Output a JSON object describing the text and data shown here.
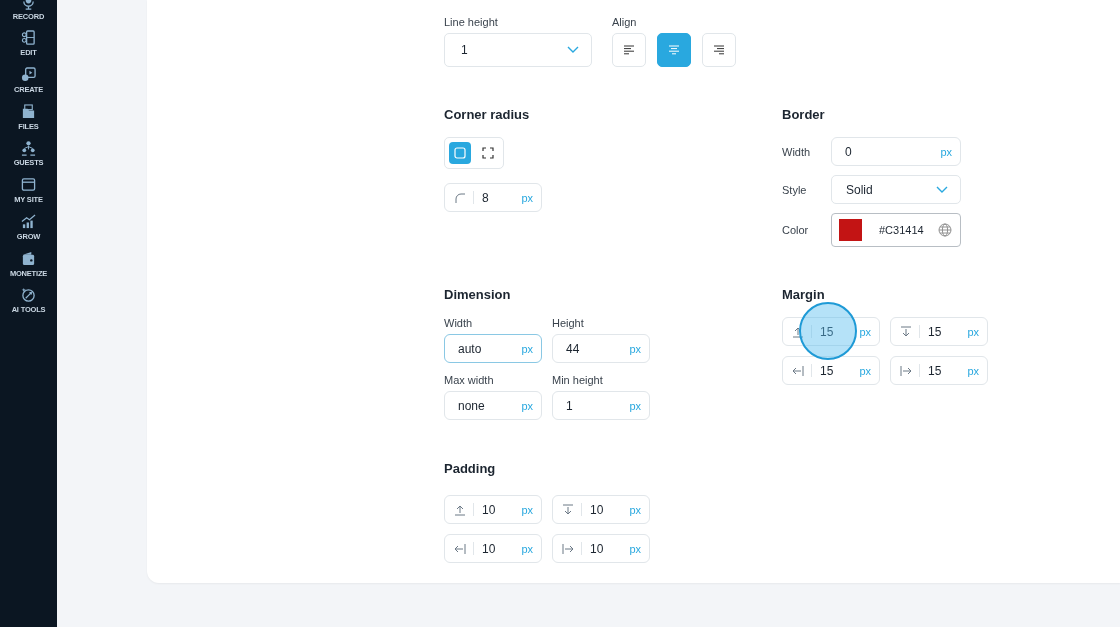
{
  "sidebar": {
    "items": [
      {
        "label": "RECORD"
      },
      {
        "label": "EDIT"
      },
      {
        "label": "CREATE"
      },
      {
        "label": "FILES"
      },
      {
        "label": "GUESTS"
      },
      {
        "label": "MY SITE"
      },
      {
        "label": "GROW"
      },
      {
        "label": "MONETIZE"
      },
      {
        "label": "AI TOOLS"
      }
    ]
  },
  "line_height": {
    "label": "Line height",
    "value": "1"
  },
  "align": {
    "label": "Align",
    "options": [
      {
        "kind": "left",
        "selected": false
      },
      {
        "kind": "center",
        "selected": true
      },
      {
        "kind": "right",
        "selected": false
      }
    ]
  },
  "corner_radius": {
    "title": "Corner radius",
    "modes": [
      {
        "kind": "uniform",
        "selected": true
      },
      {
        "kind": "individual",
        "selected": false
      }
    ],
    "field": {
      "kind": "corner",
      "value": "8",
      "unit": "px"
    }
  },
  "border": {
    "title": "Border",
    "width": {
      "label": "Width",
      "value": "0",
      "unit": "px"
    },
    "style": {
      "label": "Style",
      "value": "Solid"
    },
    "color": {
      "label": "Color",
      "color": "#c31414",
      "value": "#C31414"
    }
  },
  "dimension": {
    "title": "Dimension",
    "fields": [
      {
        "label": "Width",
        "value": "auto",
        "unit": "px",
        "focused": true
      },
      {
        "label": "Height",
        "value": "44",
        "unit": "px",
        "focused": false
      },
      {
        "label": "Max width",
        "value": "none",
        "unit": "px",
        "focused": false
      },
      {
        "label": "Min height",
        "value": "1",
        "unit": "px",
        "focused": false
      }
    ]
  },
  "margin": {
    "title": "Margin",
    "fields": [
      {
        "kind": "top",
        "value": "15",
        "unit": "px",
        "highlighted": true
      },
      {
        "kind": "bottom",
        "value": "15",
        "unit": "px",
        "highlighted": false
      },
      {
        "kind": "left",
        "value": "15",
        "unit": "px",
        "highlighted": false
      },
      {
        "kind": "right",
        "value": "15",
        "unit": "px",
        "highlighted": false
      }
    ]
  },
  "padding": {
    "title": "Padding",
    "fields": [
      {
        "kind": "top",
        "value": "10",
        "unit": "px"
      },
      {
        "kind": "bottom",
        "value": "10",
        "unit": "px"
      },
      {
        "kind": "left",
        "value": "10",
        "unit": "px"
      },
      {
        "kind": "right",
        "value": "10",
        "unit": "px"
      }
    ]
  }
}
